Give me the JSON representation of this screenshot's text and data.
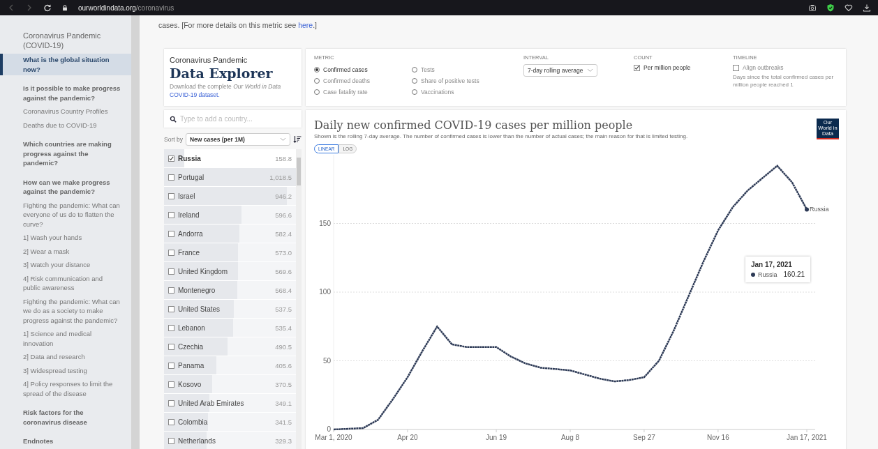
{
  "browser": {
    "url_domain": "ourworldindata.org",
    "url_path": "/coronavirus"
  },
  "sidebar": {
    "items": [
      {
        "kind": "title",
        "label": "Coronavirus Pandemic (COVID-19)",
        "selected": false
      },
      {
        "kind": "link",
        "label": "What is the global situation now?",
        "selected": true
      },
      {
        "kind": "heading",
        "label": "Is it possible to make progress against the pandemic?",
        "selected": false
      },
      {
        "kind": "link",
        "label": "Coronavirus Country Profiles",
        "selected": false
      },
      {
        "kind": "link",
        "label": "Deaths due to COVID-19",
        "selected": false
      },
      {
        "kind": "heading",
        "label": "Which countries are making progress against the pandemic?",
        "selected": false
      },
      {
        "kind": "heading",
        "label": "How can we make progress against the pandemic?",
        "selected": false
      },
      {
        "kind": "link",
        "label": "Fighting the pandemic: What can everyone of us do to flatten the curve?",
        "selected": false
      },
      {
        "kind": "link",
        "label": "1] Wash your hands",
        "selected": false
      },
      {
        "kind": "link",
        "label": "2] Wear a mask",
        "selected": false
      },
      {
        "kind": "link",
        "label": "3] Watch your distance",
        "selected": false
      },
      {
        "kind": "link",
        "label": "4] Risk communication and public awareness",
        "selected": false
      },
      {
        "kind": "link",
        "label": "Fighting the pandemic: What can we do as a society to make progress against the pandemic?",
        "selected": false
      },
      {
        "kind": "link",
        "label": "1] Science and medical innovation",
        "selected": false
      },
      {
        "kind": "link",
        "label": "2] Data and research",
        "selected": false
      },
      {
        "kind": "link",
        "label": "3] Widespread testing",
        "selected": false
      },
      {
        "kind": "link",
        "label": "4] Policy responses to limit the spread of the disease",
        "selected": false
      },
      {
        "kind": "heading",
        "label": "Risk factors for the coronavirus disease",
        "selected": false
      },
      {
        "kind": "heading",
        "label": "Endnotes",
        "selected": false
      }
    ]
  },
  "intro": {
    "text": "cases. [For more details on this metric see ",
    "link": "here",
    "after": ".]"
  },
  "explorer": {
    "kicker": "Coronavirus Pandemic",
    "title": "Data Explorer",
    "download_text": "Download the complete *Our World in Data* ",
    "download_link": "COVID-19 dataset."
  },
  "controls": {
    "metric_label": "METRIC",
    "metrics": [
      {
        "label": "Confirmed cases",
        "selected": true
      },
      {
        "label": "Confirmed deaths",
        "selected": false
      },
      {
        "label": "Case fatality rate",
        "selected": false
      },
      {
        "label": "Tests",
        "selected": false
      },
      {
        "label": "Share of positive tests",
        "selected": false
      },
      {
        "label": "Vaccinations",
        "selected": false
      }
    ],
    "interval_label": "INTERVAL",
    "interval_value": "7-day rolling average",
    "count_label": "COUNT",
    "count_option": {
      "label": "Per million people",
      "checked": true
    },
    "timeline_label": "TIMELINE",
    "timeline_option": {
      "label": "Align outbreaks",
      "checked": false
    },
    "timeline_note": "Days since the total confirmed cases per million people reached 1"
  },
  "search": {
    "placeholder": "Type to add a country..."
  },
  "sort": {
    "label": "Sort by",
    "value": "New cases (per 1M)"
  },
  "countries": [
    {
      "name": "Russia",
      "value": "158.8",
      "checked": true,
      "level": 0.156
    },
    {
      "name": "Portugal",
      "value": "1,018.5",
      "checked": false,
      "level": 1
    },
    {
      "name": "Israel",
      "value": "946.2",
      "checked": false,
      "level": 0.929
    },
    {
      "name": "Ireland",
      "value": "596.6",
      "checked": false,
      "level": 0.586
    },
    {
      "name": "Andorra",
      "value": "582.4",
      "checked": false,
      "level": 0.572
    },
    {
      "name": "France",
      "value": "573.0",
      "checked": false,
      "level": 0.563
    },
    {
      "name": "United Kingdom",
      "value": "569.6",
      "checked": false,
      "level": 0.559
    },
    {
      "name": "Montenegro",
      "value": "568.4",
      "checked": false,
      "level": 0.558
    },
    {
      "name": "United States",
      "value": "537.5",
      "checked": false,
      "level": 0.528
    },
    {
      "name": "Lebanon",
      "value": "535.4",
      "checked": false,
      "level": 0.526
    },
    {
      "name": "Czechia",
      "value": "490.5",
      "checked": false,
      "level": 0.482
    },
    {
      "name": "Panama",
      "value": "405.6",
      "checked": false,
      "level": 0.398
    },
    {
      "name": "Kosovo",
      "value": "370.5",
      "checked": false,
      "level": 0.364
    },
    {
      "name": "United Arab Emirates",
      "value": "349.1",
      "checked": false,
      "level": 0.343
    },
    {
      "name": "Colombia",
      "value": "341.5",
      "checked": false,
      "level": 0.335
    },
    {
      "name": "Netherlands",
      "value": "329.3",
      "checked": false,
      "level": 0.323
    }
  ],
  "chart": {
    "title": "Daily new confirmed COVID-19 cases per million people",
    "subtitle": "Shown is the rolling 7-day average. The number of confirmed cases is lower than the number of actual cases; the main reason for that is limited testing.",
    "scale_toggle": [
      {
        "label": "LINEAR",
        "selected": true
      },
      {
        "label": "LOG",
        "selected": false
      }
    ],
    "logo": "Our World in Data",
    "tooltip": {
      "date": "Jan 17, 2021",
      "series": "Russia",
      "value": "160.21"
    },
    "chart_data": {
      "type": "line",
      "categories": [
        "Mar 1, 2020",
        null,
        null,
        null,
        null,
        "Apr 20",
        null,
        null,
        null,
        null,
        null,
        "Jun 19",
        null,
        null,
        null,
        null,
        "Aug 8",
        null,
        null,
        null,
        null,
        "Sep 27",
        null,
        null,
        null,
        null,
        "Nov 16",
        null,
        null,
        null,
        null,
        null,
        "Jan 17, 2021"
      ],
      "series": [
        {
          "name": "Russia",
          "color": "#2d3a56",
          "line_style": "dotted",
          "values": [
            0,
            0.5,
            1,
            7,
            22,
            38,
            57,
            75,
            62,
            60,
            60,
            60,
            53,
            48,
            45,
            44,
            43,
            40,
            37,
            35,
            36,
            38,
            50,
            72,
            97,
            122,
            145,
            162,
            174,
            183,
            192,
            180,
            160.21
          ]
        }
      ],
      "grid": true,
      "ylim": [
        0,
        200
      ],
      "yticks": [
        0,
        50,
        100,
        150
      ]
    }
  }
}
